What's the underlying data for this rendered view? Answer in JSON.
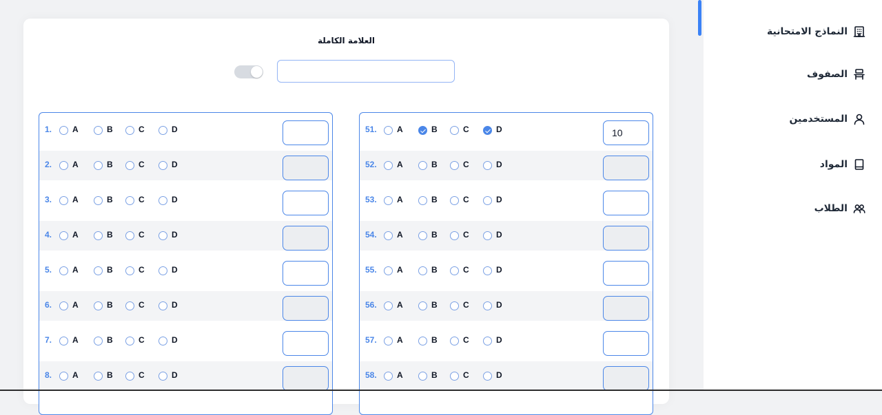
{
  "sidebar": {
    "items": [
      {
        "label": "النماذج الامتحانية",
        "icon": "building-icon"
      },
      {
        "label": "الصفوف",
        "icon": "desk-icon"
      },
      {
        "label": "المستخدمين",
        "icon": "user-icon"
      },
      {
        "label": "المواد",
        "icon": "book-icon"
      },
      {
        "label": "الطلاب",
        "icon": "users-icon"
      }
    ]
  },
  "exam": {
    "full_mark_label": "العلامة الكاملة",
    "full_mark_value": "",
    "toggle_on": false
  },
  "options": [
    "A",
    "B",
    "C",
    "D"
  ],
  "left_questions": [
    {
      "num": "1.",
      "selected": [],
      "score": ""
    },
    {
      "num": "2.",
      "selected": [],
      "score": ""
    },
    {
      "num": "3.",
      "selected": [],
      "score": ""
    },
    {
      "num": "4.",
      "selected": [],
      "score": ""
    },
    {
      "num": "5.",
      "selected": [],
      "score": ""
    },
    {
      "num": "6.",
      "selected": [],
      "score": ""
    },
    {
      "num": "7.",
      "selected": [],
      "score": ""
    },
    {
      "num": "8.",
      "selected": [],
      "score": ""
    }
  ],
  "right_questions": [
    {
      "num": "51.",
      "selected": [
        "B",
        "D"
      ],
      "score": "10"
    },
    {
      "num": "52.",
      "selected": [],
      "score": ""
    },
    {
      "num": "53.",
      "selected": [],
      "score": ""
    },
    {
      "num": "54.",
      "selected": [],
      "score": ""
    },
    {
      "num": "55.",
      "selected": [],
      "score": ""
    },
    {
      "num": "56.",
      "selected": [],
      "score": ""
    },
    {
      "num": "57.",
      "selected": [],
      "score": ""
    },
    {
      "num": "58.",
      "selected": [],
      "score": ""
    }
  ],
  "colors": {
    "accent": "#4a86e8",
    "row_alt": "#f3f4f6",
    "page_bg": "#f1f2f4"
  }
}
